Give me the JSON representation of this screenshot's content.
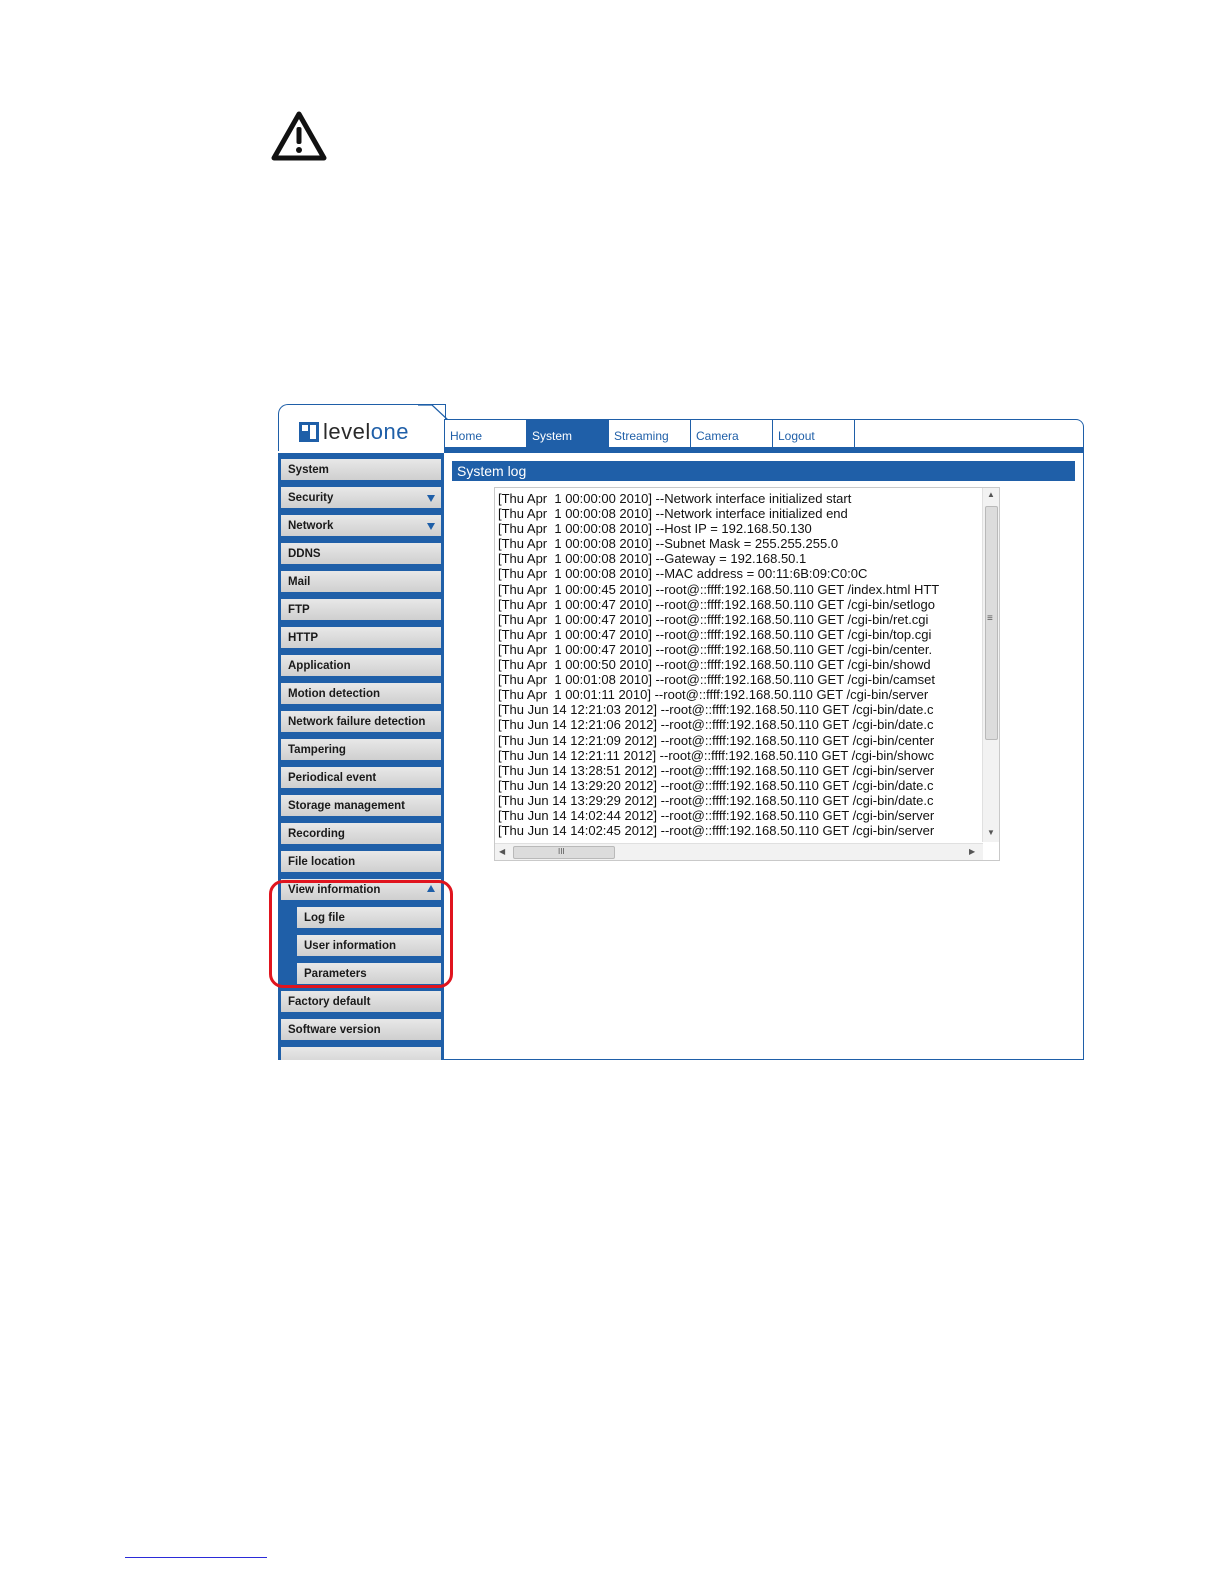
{
  "icons": {
    "warning": "warning-triangle-icon",
    "scroll_up": "▲",
    "scroll_down": "▼",
    "scroll_left": "◀",
    "scroll_right": "▶",
    "grip": "≡",
    "hgrip": "III"
  },
  "colors": {
    "brand_blue": "#1f5fa8",
    "highlight_red": "#e0141e"
  },
  "logo": {
    "text_a": "level",
    "text_b": "one"
  },
  "topnav": {
    "tabs": [
      {
        "label": "Home",
        "active": false
      },
      {
        "label": "System",
        "active": true
      },
      {
        "label": "Streaming",
        "active": false
      },
      {
        "label": "Camera",
        "active": false
      },
      {
        "label": "Logout",
        "active": false
      }
    ]
  },
  "sidebar": {
    "items": [
      {
        "label": "System"
      },
      {
        "label": "Security",
        "arrow": "down"
      },
      {
        "label": "Network",
        "arrow": "down"
      },
      {
        "label": "DDNS"
      },
      {
        "label": "Mail"
      },
      {
        "label": "FTP"
      },
      {
        "label": "HTTP"
      },
      {
        "label": "Application"
      },
      {
        "label": "Motion detection"
      },
      {
        "label": "Network failure detection"
      },
      {
        "label": "Tampering"
      },
      {
        "label": "Periodical event"
      },
      {
        "label": "Storage management"
      },
      {
        "label": "Recording"
      },
      {
        "label": "File location"
      },
      {
        "label": "View information",
        "arrow": "up"
      },
      {
        "label": "Log file",
        "sub": true
      },
      {
        "label": "User information",
        "sub": true
      },
      {
        "label": "Parameters",
        "sub": true
      },
      {
        "label": "Factory default"
      },
      {
        "label": "Software version"
      }
    ]
  },
  "main": {
    "title": "System log",
    "log_lines": [
      "[Thu Apr  1 00:00:00 2010] --Network interface initialized start",
      "[Thu Apr  1 00:00:08 2010] --Network interface initialized end",
      "[Thu Apr  1 00:00:08 2010] --Host IP = 192.168.50.130",
      "[Thu Apr  1 00:00:08 2010] --Subnet Mask = 255.255.255.0",
      "[Thu Apr  1 00:00:08 2010] --Gateway = 192.168.50.1",
      "[Thu Apr  1 00:00:08 2010] --MAC address = 00:11:6B:09:C0:0C",
      "[Thu Apr  1 00:00:45 2010] --root@::ffff:192.168.50.110 GET /index.html HTT",
      "[Thu Apr  1 00:00:47 2010] --root@::ffff:192.168.50.110 GET /cgi-bin/setlogo",
      "[Thu Apr  1 00:00:47 2010] --root@::ffff:192.168.50.110 GET /cgi-bin/ret.cgi",
      "[Thu Apr  1 00:00:47 2010] --root@::ffff:192.168.50.110 GET /cgi-bin/top.cgi",
      "[Thu Apr  1 00:00:47 2010] --root@::ffff:192.168.50.110 GET /cgi-bin/center.",
      "[Thu Apr  1 00:00:50 2010] --root@::ffff:192.168.50.110 GET /cgi-bin/showd",
      "[Thu Apr  1 00:01:08 2010] --root@::ffff:192.168.50.110 GET /cgi-bin/camset",
      "[Thu Apr  1 00:01:11 2010] --root@::ffff:192.168.50.110 GET /cgi-bin/server",
      "[Thu Jun 14 12:21:03 2012] --root@::ffff:192.168.50.110 GET /cgi-bin/date.c",
      "[Thu Jun 14 12:21:06 2012] --root@::ffff:192.168.50.110 GET /cgi-bin/date.c",
      "[Thu Jun 14 12:21:09 2012] --root@::ffff:192.168.50.110 GET /cgi-bin/center",
      "[Thu Jun 14 12:21:11 2012] --root@::ffff:192.168.50.110 GET /cgi-bin/showc",
      "[Thu Jun 14 13:28:51 2012] --root@::ffff:192.168.50.110 GET /cgi-bin/server",
      "[Thu Jun 14 13:29:20 2012] --root@::ffff:192.168.50.110 GET /cgi-bin/date.c",
      "[Thu Jun 14 13:29:29 2012] --root@::ffff:192.168.50.110 GET /cgi-bin/date.c",
      "[Thu Jun 14 14:02:44 2012] --root@::ffff:192.168.50.110 GET /cgi-bin/server",
      "[Thu Jun 14 14:02:45 2012] --root@::ffff:192.168.50.110 GET /cgi-bin/server"
    ]
  }
}
